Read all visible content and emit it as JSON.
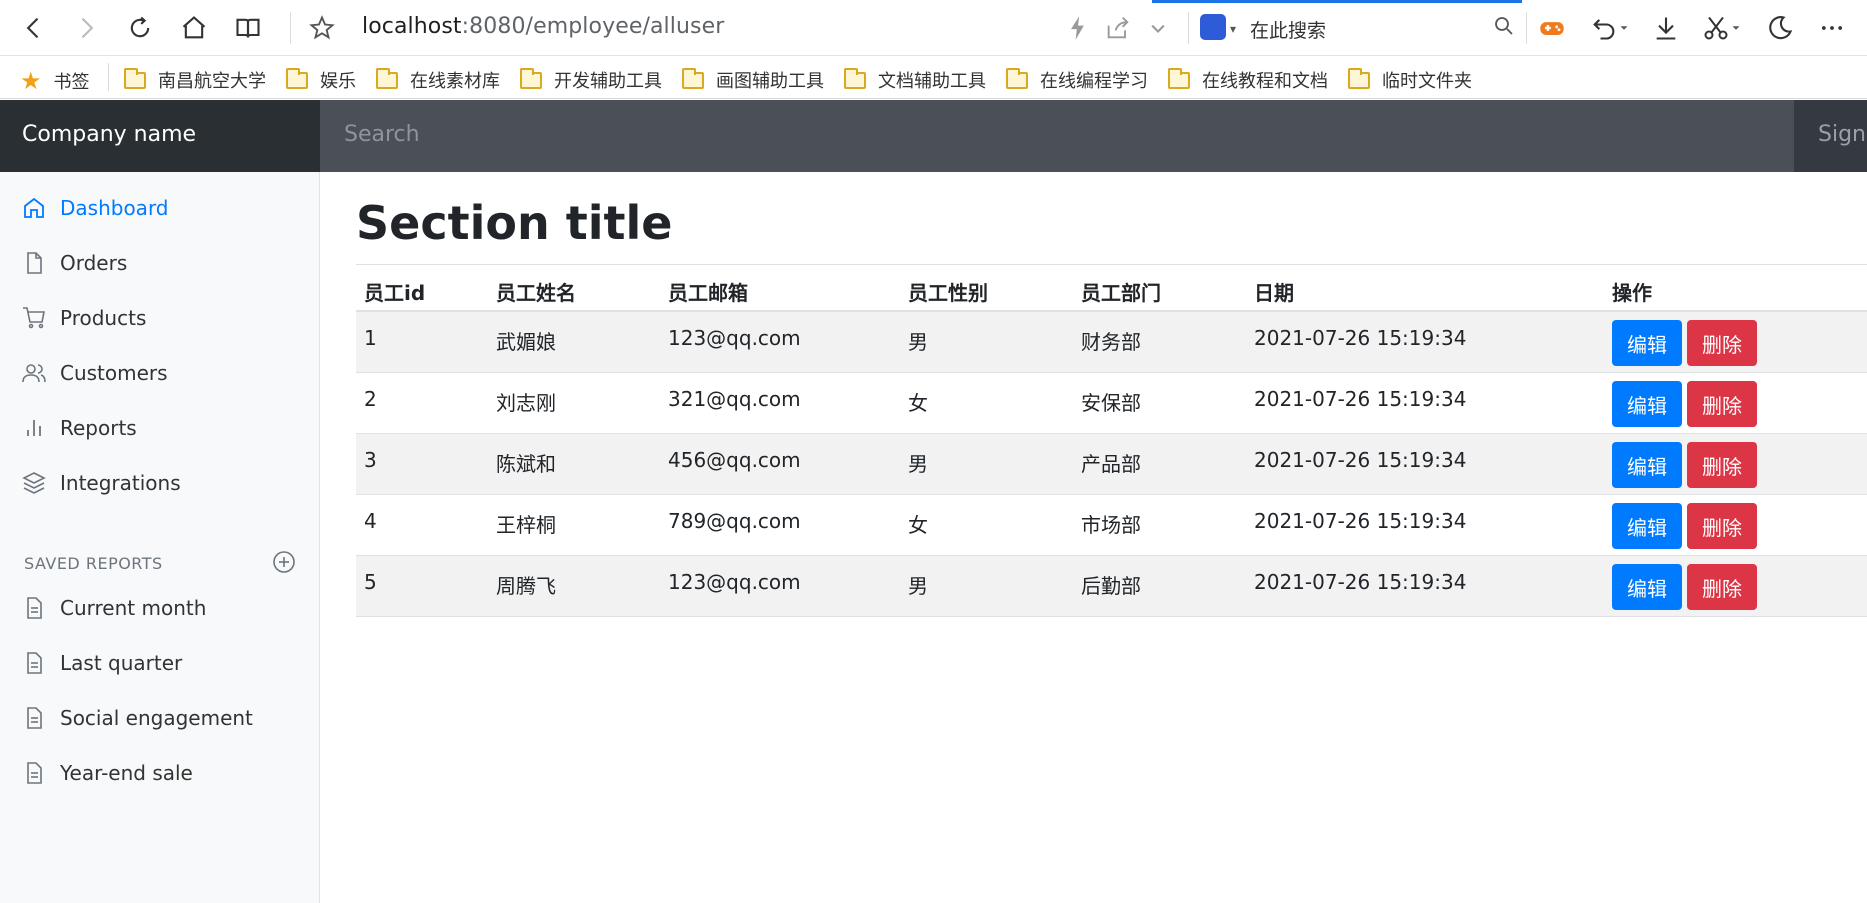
{
  "browser": {
    "url_host": "localhost",
    "url_rest": ":8080/employee/alluser",
    "search_placeholder": "在此搜索"
  },
  "bookmarks": {
    "root_label": "书签",
    "folders": [
      "南昌航空大学",
      "娱乐",
      "在线素材库",
      "开发辅助工具",
      "画图辅助工具",
      "文档辅助工具",
      "在线编程学习",
      "在线教程和文档",
      "临时文件夹"
    ]
  },
  "navbar": {
    "brand": "Company name",
    "search_placeholder": "Search",
    "signout": "Sign out"
  },
  "sidebar": {
    "items": [
      {
        "label": "Dashboard",
        "icon": "home-icon",
        "active": true
      },
      {
        "label": "Orders",
        "icon": "file-icon"
      },
      {
        "label": "Products",
        "icon": "shopping-cart-icon"
      },
      {
        "label": "Customers",
        "icon": "users-icon"
      },
      {
        "label": "Reports",
        "icon": "bar-chart-icon"
      },
      {
        "label": "Integrations",
        "icon": "layers-icon"
      }
    ],
    "saved_heading": "SAVED REPORTS",
    "saved_items": [
      "Current month",
      "Last quarter",
      "Social engagement",
      "Year-end sale"
    ]
  },
  "main": {
    "title": "Section title",
    "table": {
      "headers": [
        "员工id",
        "员工姓名",
        "员工邮箱",
        "员工性别",
        "员工部门",
        "日期",
        "操作"
      ],
      "rows": [
        [
          "1",
          "武媚娘",
          "123@qq.com",
          "男",
          "财务部",
          "2021-07-26 15:19:34"
        ],
        [
          "2",
          "刘志刚",
          "321@qq.com",
          "女",
          "安保部",
          "2021-07-26 15:19:34"
        ],
        [
          "3",
          "陈斌和",
          "456@qq.com",
          "男",
          "产品部",
          "2021-07-26 15:19:34"
        ],
        [
          "4",
          "王梓桐",
          "789@qq.com",
          "女",
          "市场部",
          "2021-07-26 15:19:34"
        ],
        [
          "5",
          "周腾飞",
          "123@qq.com",
          "男",
          "后勤部",
          "2021-07-26 15:19:34"
        ]
      ],
      "edit_label": "编辑",
      "delete_label": "删除"
    }
  },
  "colors": {
    "primary": "#007bff",
    "danger": "#dc3545",
    "navbar": "#343a40"
  }
}
